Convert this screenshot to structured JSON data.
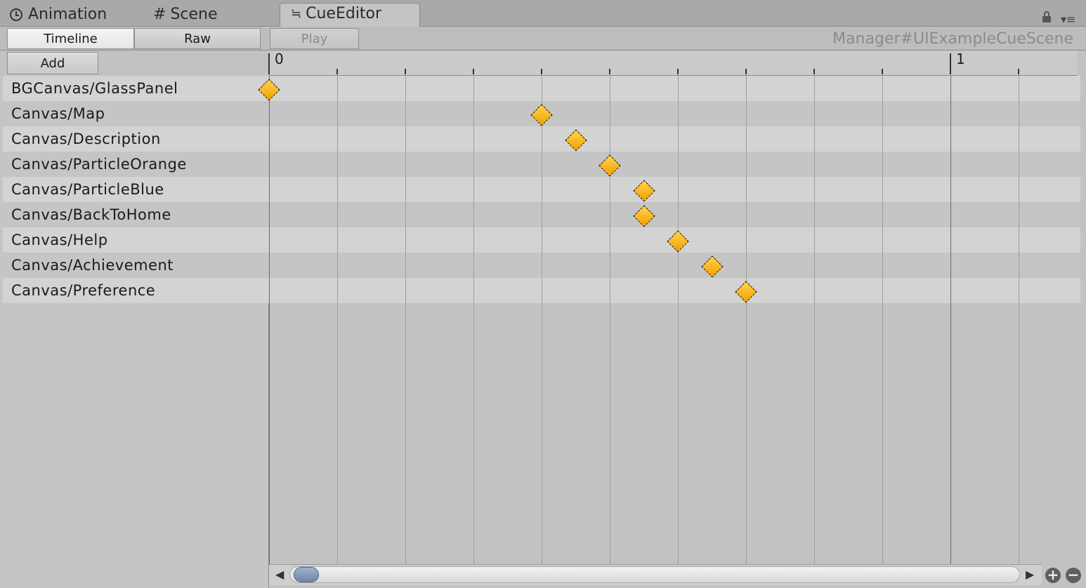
{
  "window_tabs": [
    {
      "label": "Animation",
      "icon": "clock-icon"
    },
    {
      "label": "Scene",
      "icon": "hash-icon"
    },
    {
      "label": "CueEditor",
      "icon": "cue-icon",
      "active": true
    }
  ],
  "toolbar": {
    "timeline_label": "Timeline",
    "raw_label": "Raw",
    "play_label": "Play",
    "scene_title": "Manager#UIExampleCueScene"
  },
  "header": {
    "add_label": "Add"
  },
  "ruler": {
    "labels": [
      "0",
      "1"
    ]
  },
  "tracks": [
    {
      "name": "BGCanvas/GlassPanel",
      "key_time": 0.0
    },
    {
      "name": "Canvas/Map",
      "key_time": 0.4
    },
    {
      "name": "Canvas/Description",
      "key_time": 0.45
    },
    {
      "name": "Canvas/ParticleOrange",
      "key_time": 0.5
    },
    {
      "name": "Canvas/ParticleBlue",
      "key_time": 0.55
    },
    {
      "name": "Canvas/BackToHome",
      "key_time": 0.55
    },
    {
      "name": "Canvas/Help",
      "key_time": 0.6
    },
    {
      "name": "Canvas/Achievement",
      "key_time": 0.65
    },
    {
      "name": "Canvas/Preference",
      "key_time": 0.7
    }
  ],
  "scrollbar": {
    "left_arrow": "◀",
    "right_arrow": "▶",
    "zoom_in": "+",
    "zoom_out": "−"
  },
  "colors": {
    "keyframe": "#f5a800",
    "background": "#c2c2c2"
  }
}
